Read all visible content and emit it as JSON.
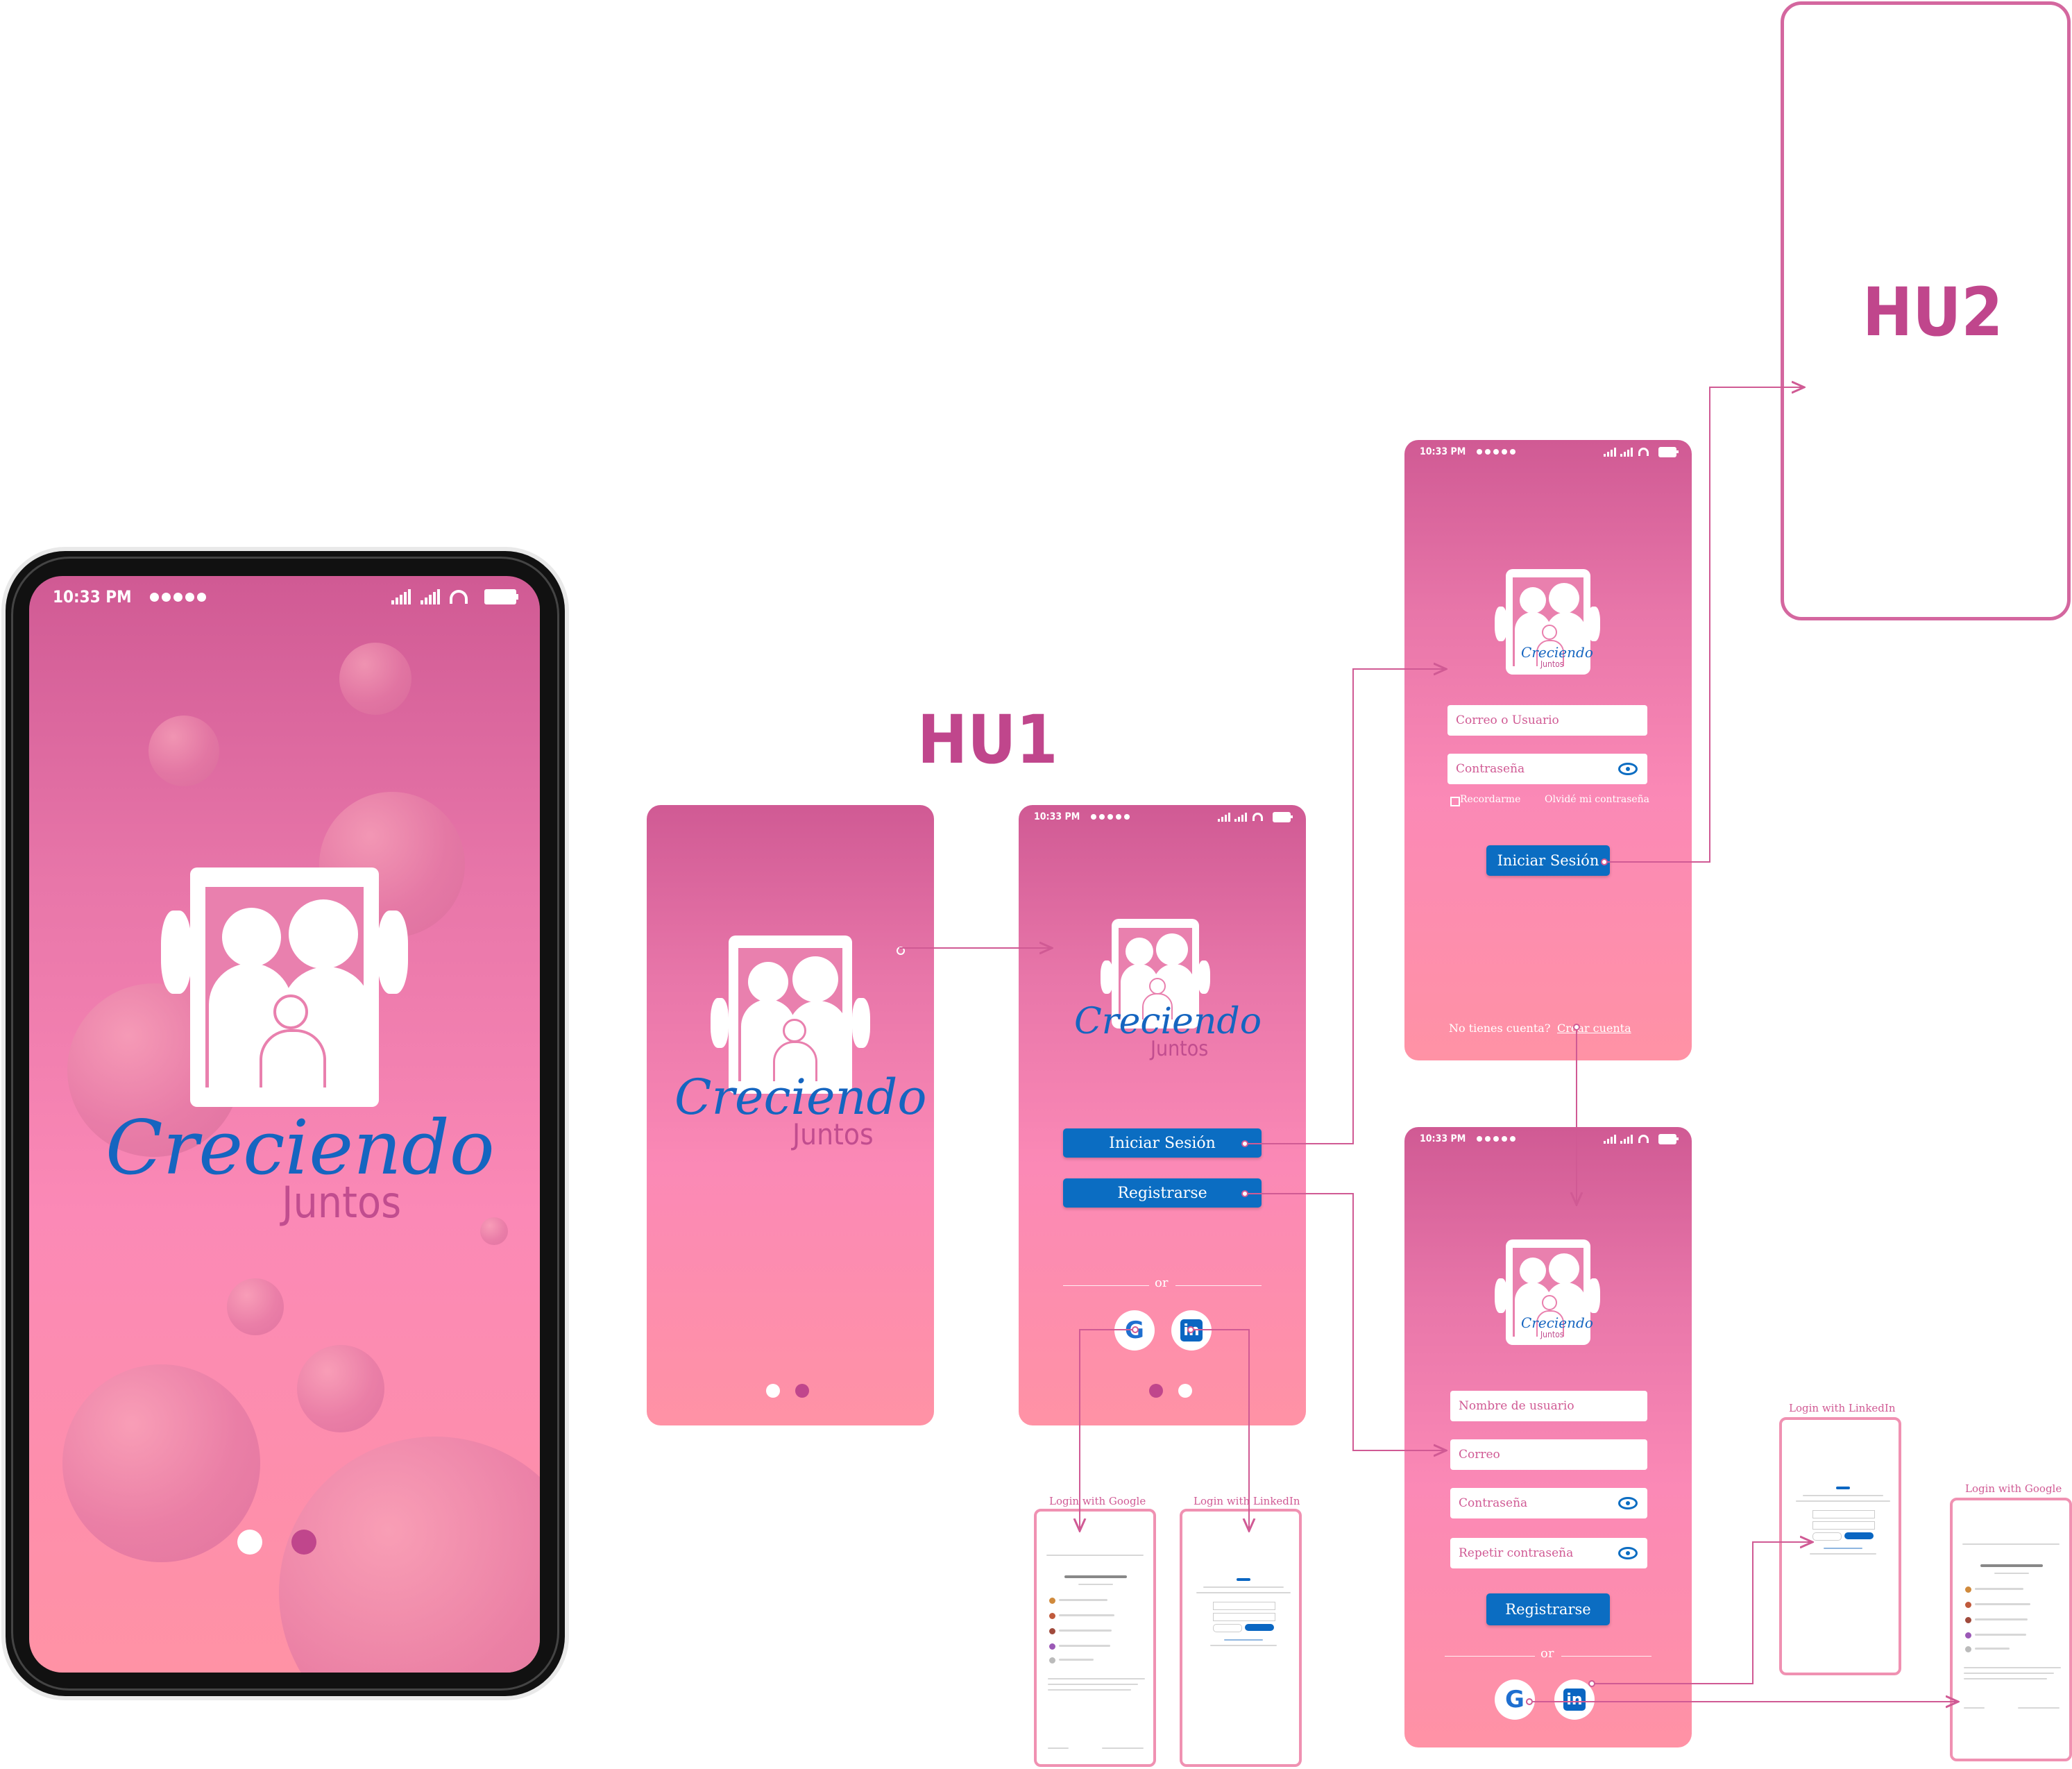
{
  "status": {
    "time": "10:33 PM"
  },
  "app": {
    "name_script": "Creciendo",
    "name_sub": "Juntos"
  },
  "labels": {
    "hu1": "HU1",
    "hu2": "HU2"
  },
  "login": {
    "user_placeholder": "Correo o Usuario",
    "password_placeholder": "Contraseña",
    "remember": "Recordarme",
    "forgot": "Olvidé mi contraseña",
    "submit": "Iniciar Sesión",
    "no_account": "No tienes cuenta?",
    "create_account": "Crear cuenta"
  },
  "welcome": {
    "login_button": "Iniciar Sesión",
    "register_button": "Registrarse",
    "or": "or"
  },
  "register": {
    "username_placeholder": "Nombre de usuario",
    "email_placeholder": "Correo",
    "password_placeholder": "Contraseña",
    "repeat_password_placeholder": "Repetir contraseña",
    "submit": "Registrarse",
    "or": "or"
  },
  "oauth": {
    "google_title": "Login with Google",
    "linkedin_title": "Login with LinkedIn"
  },
  "colors": {
    "accent_pink": "#d05a94",
    "button_blue": "#0b6dc2",
    "frame_pink": "#f091b2"
  }
}
